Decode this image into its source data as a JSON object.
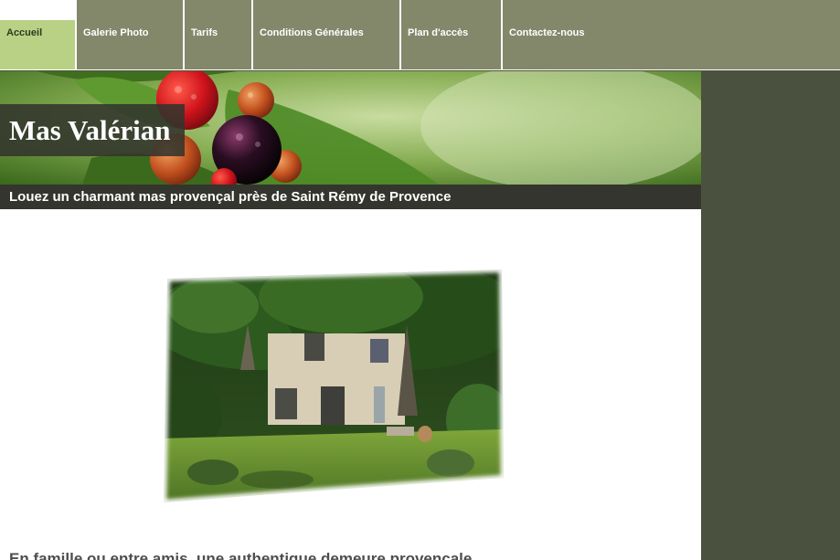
{
  "nav": {
    "items": [
      {
        "label": "Accueil",
        "active": true
      },
      {
        "label": "Galerie Photo",
        "active": false
      },
      {
        "label": "Tarifs",
        "active": false
      },
      {
        "label": "Conditions Générales",
        "active": false
      },
      {
        "label": "Plan d'accès",
        "active": false
      },
      {
        "label": "Contactez-nous",
        "active": false
      }
    ]
  },
  "header": {
    "site_title": "Mas Valérian",
    "tagline": "Louez un charmant mas provençal près de Saint Rémy de Provence"
  },
  "main": {
    "intro_heading": "En famille ou entre amis, une authentique demeure provençale"
  },
  "colors": {
    "nav_bg": "#83886b",
    "nav_active": "#b8d185",
    "side_bg": "#4b513f",
    "tagline_bg": "#33352e"
  }
}
